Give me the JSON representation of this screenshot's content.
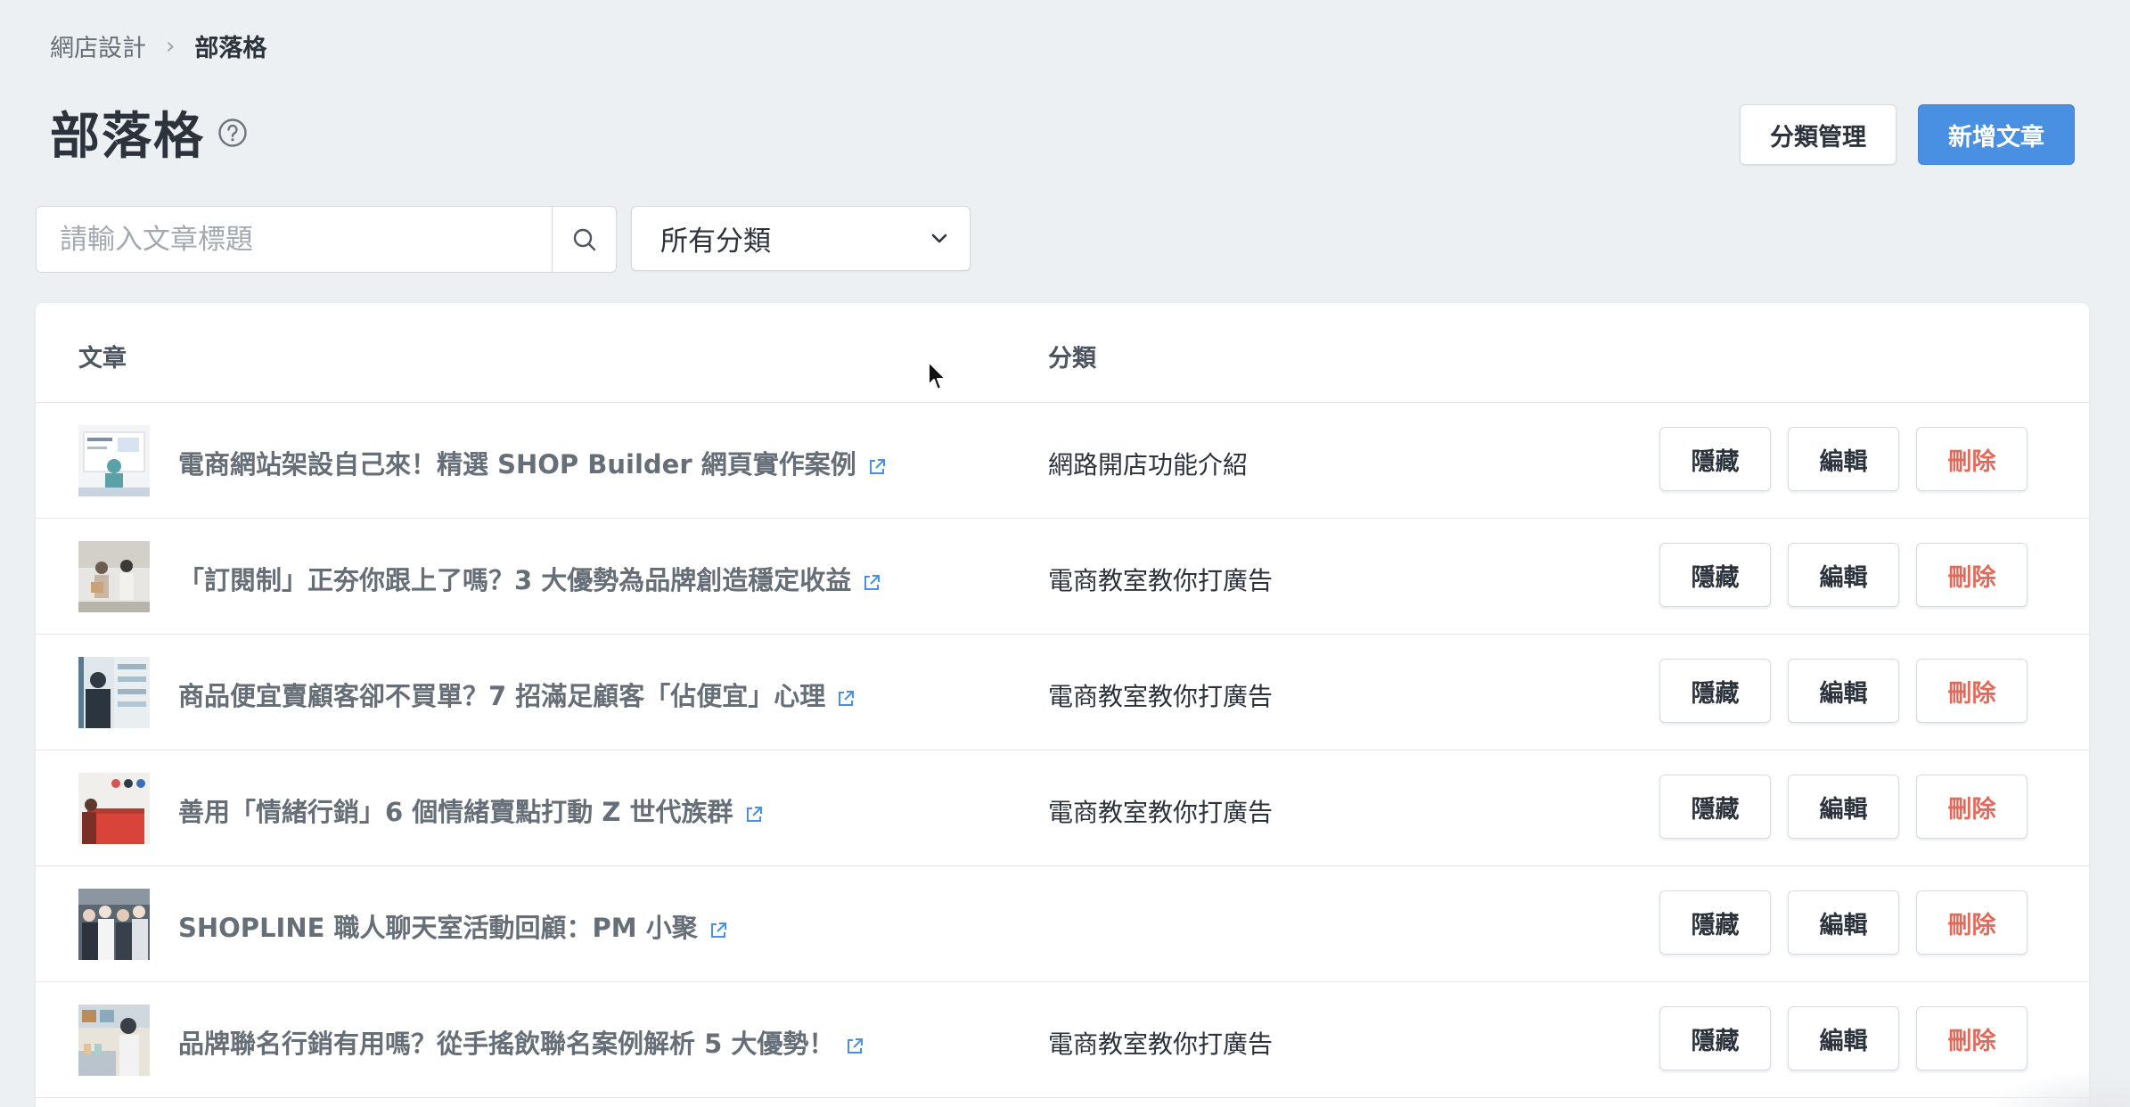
{
  "breadcrumb": {
    "parent": "網店設計",
    "current": "部落格"
  },
  "page": {
    "title": "部落格"
  },
  "header_actions": {
    "category_manage": "分類管理",
    "new_post": "新增文章"
  },
  "filters": {
    "search_placeholder": "請輸入文章標題",
    "category_selected": "所有分類"
  },
  "table": {
    "columns": {
      "article": "文章",
      "category": "分類"
    },
    "actions": {
      "hide": "隱藏",
      "edit": "編輯",
      "delete": "刪除"
    },
    "rows": [
      {
        "title": "電商網站架設自己來！精選 SHOP Builder 網頁實作案例",
        "category": "網路開店功能介紹"
      },
      {
        "title": "「訂閱制」正夯你跟上了嗎？3 大優勢為品牌創造穩定收益",
        "category": "電商教室教你打廣告"
      },
      {
        "title": "商品便宜賣顧客卻不買單？7 招滿足顧客「佔便宜」心理",
        "category": "電商教室教你打廣告"
      },
      {
        "title": "善用「情緒行銷」6 個情緒賣點打動 Z 世代族群",
        "category": "電商教室教你打廣告"
      },
      {
        "title": "SHOPLINE 職人聊天室活動回顧：PM 小聚",
        "category": ""
      },
      {
        "title": "品牌聯名行銷有用嗎？從手搖飲聯名案例解析 5 大優勢！",
        "category": "電商教室教你打廣告"
      }
    ]
  },
  "colors": {
    "primary": "#4a90e2",
    "danger": "#e26a5a",
    "background": "#edf0f2"
  }
}
